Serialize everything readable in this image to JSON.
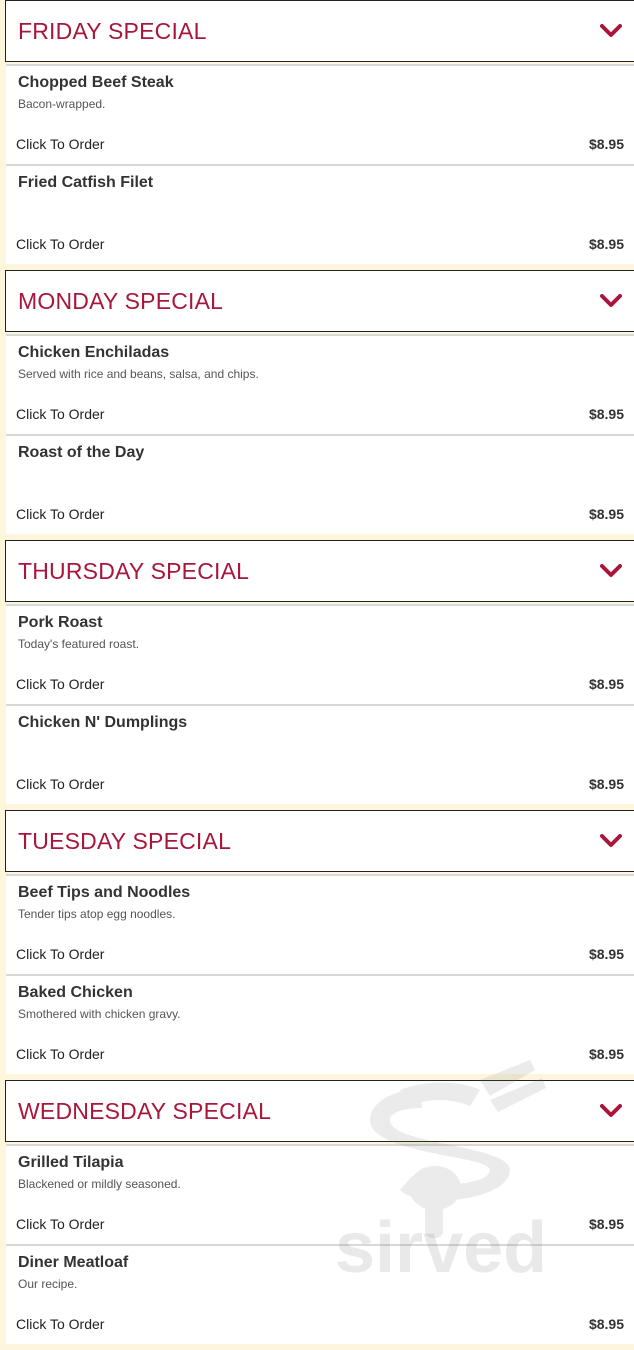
{
  "colors": {
    "accent": "#a8173b",
    "background": "#fdf6dc",
    "card": "#ffffff",
    "divider": "#d8d8d8"
  },
  "icons": {
    "section_toggle": "chevron-down-icon",
    "watermark": "sirved-logo-icon"
  },
  "watermark": {
    "text": "sirved"
  },
  "sections": [
    {
      "title": "FRIDAY SPECIAL",
      "items": [
        {
          "name": "Chopped Beef Steak",
          "description": "Bacon-wrapped.",
          "order": "Click To Order",
          "price": "$8.95"
        },
        {
          "name": "Fried Catfish Filet",
          "description": "",
          "order": "Click To Order",
          "price": "$8.95"
        }
      ]
    },
    {
      "title": "MONDAY SPECIAL",
      "items": [
        {
          "name": "Chicken Enchiladas",
          "description": "Served with rice and beans, salsa, and chips.",
          "order": "Click To Order",
          "price": "$8.95"
        },
        {
          "name": "Roast of the Day",
          "description": "",
          "order": "Click To Order",
          "price": "$8.95"
        }
      ]
    },
    {
      "title": "THURSDAY SPECIAL",
      "items": [
        {
          "name": "Pork Roast",
          "description": "Today's featured roast.",
          "order": "Click To Order",
          "price": "$8.95"
        },
        {
          "name": "Chicken N' Dumplings",
          "description": "",
          "order": "Click To Order",
          "price": "$8.95"
        }
      ]
    },
    {
      "title": "TUESDAY SPECIAL",
      "items": [
        {
          "name": "Beef Tips and Noodles",
          "description": "Tender tips atop egg noodles.",
          "order": "Click To Order",
          "price": "$8.95"
        },
        {
          "name": "Baked Chicken",
          "description": "Smothered with chicken gravy.",
          "order": "Click To Order",
          "price": "$8.95"
        }
      ]
    },
    {
      "title": "WEDNESDAY SPECIAL",
      "items": [
        {
          "name": "Grilled Tilapia",
          "description": "Blackened or mildly seasoned.",
          "order": "Click To Order",
          "price": "$8.95"
        },
        {
          "name": "Diner Meatloaf",
          "description": "Our recipe.",
          "order": "Click To Order",
          "price": "$8.95"
        }
      ]
    }
  ]
}
